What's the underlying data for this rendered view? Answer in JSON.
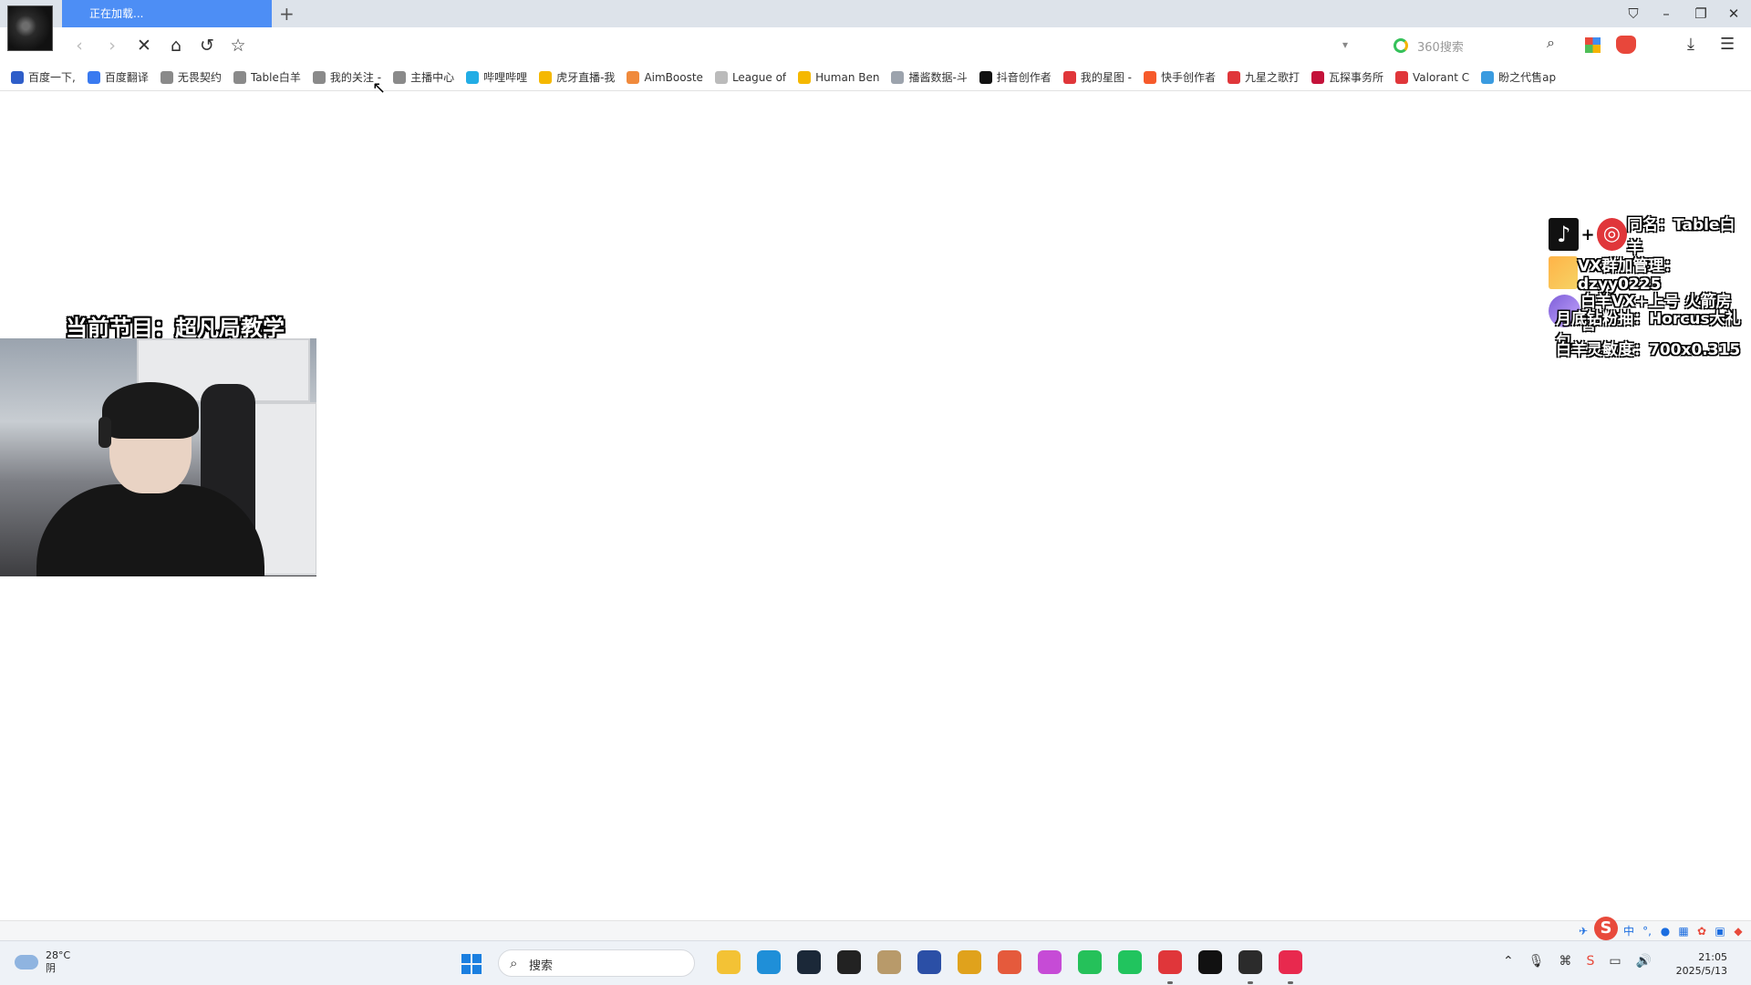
{
  "browser": {
    "active_tab_title": "正在加载...",
    "new_tab_symbol": "+",
    "search_placeholder": "360搜索",
    "bookmarks": [
      {
        "label": "百度一下,",
        "color": "#2f5ec9"
      },
      {
        "label": "百度翻译",
        "color": "#3a7af0"
      },
      {
        "label": "无畏契约",
        "color": "#8a8a8a"
      },
      {
        "label": "Table白羊",
        "color": "#8a8a8a"
      },
      {
        "label": "我的关注 -",
        "color": "#8a8a8a"
      },
      {
        "label": "主播中心",
        "color": "#8a8a8a"
      },
      {
        "label": "哔哩哔哩",
        "color": "#23ade5"
      },
      {
        "label": "虎牙直播-我",
        "color": "#f5b800"
      },
      {
        "label": "AimBooste",
        "color": "#f08a3c"
      },
      {
        "label": "League of",
        "color": "#bbbbbb"
      },
      {
        "label": "Human Ben",
        "color": "#f5b800"
      },
      {
        "label": "播酱数据-斗",
        "color": "#9ca3ad"
      },
      {
        "label": "抖音创作者",
        "color": "#111111"
      },
      {
        "label": "我的星图 -",
        "color": "#e0363a"
      },
      {
        "label": "快手创作者",
        "color": "#f65a2b"
      },
      {
        "label": "九星之歌打",
        "color": "#e0363a"
      },
      {
        "label": "瓦探事务所",
        "color": "#c4123a"
      },
      {
        "label": "Valorant C",
        "color": "#e0363a"
      },
      {
        "label": "盼之代售ap",
        "color": "#3a9be0"
      }
    ]
  },
  "stream": {
    "program_title": "当前节目：超凡局教学",
    "social_line1": "同名：Table白羊",
    "social_line2": "VX群加管理：dzyy0225",
    "social_line3": "白羊VX+上号 火箭房管",
    "social_line4": "月底钻粉抽：Horcus大礼包",
    "social_line5": "白羊灵敏度：700x0.315",
    "plus_symbol": "+"
  },
  "ime": {
    "lang_label": "中",
    "punct_label": "°,"
  },
  "taskbar": {
    "temperature": "28°C",
    "weather_desc": "阴",
    "search_label": "搜索",
    "time": "21:05",
    "date": "2025/5/13",
    "apps": [
      {
        "name": "file-explorer-icon",
        "color": "#f3c235"
      },
      {
        "name": "edge-icon",
        "color": "#1f8fd8"
      },
      {
        "name": "steam-icon",
        "color": "#1b2838"
      },
      {
        "name": "qq-icon",
        "color": "#222222"
      },
      {
        "name": "bag-icon",
        "color": "#b89a6a"
      },
      {
        "name": "circle-app-icon",
        "color": "#2b4fa6"
      },
      {
        "name": "glasses-app-icon",
        "color": "#e0a21c"
      },
      {
        "name": "paper-plane-icon",
        "color": "#e55a3c"
      },
      {
        "name": "color-wheel-icon",
        "color": "#c64bd6"
      },
      {
        "name": "play-icon",
        "color": "#25c15a"
      },
      {
        "name": "wechat-icon",
        "color": "#21c45e"
      },
      {
        "name": "netease-music-icon",
        "color": "#e0363a"
      },
      {
        "name": "g-app-icon",
        "color": "#111111"
      },
      {
        "name": "obs-icon",
        "color": "#2b2b2b"
      },
      {
        "name": "live-app-icon",
        "color": "#e8294e"
      }
    ]
  }
}
